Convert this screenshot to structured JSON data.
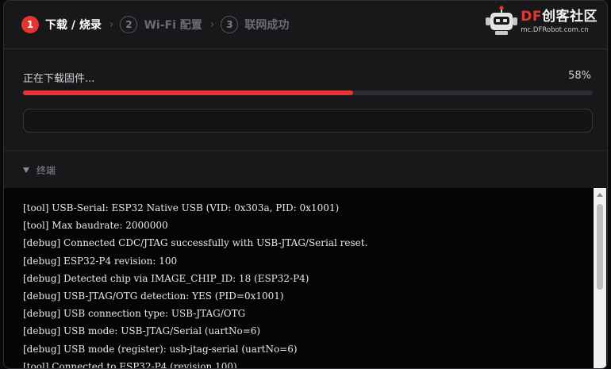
{
  "steps": [
    {
      "number": "1",
      "label": "下载 / 烧录"
    },
    {
      "number": "2",
      "label": "Wi-Fi 配置"
    },
    {
      "number": "3",
      "label": "联网成功"
    }
  ],
  "step_separator": "›",
  "logo": {
    "brand_df": "DF",
    "brand_rest": "创客社区",
    "url": "mc.DFRobot.com.cn"
  },
  "progress": {
    "status": "正在下载固件...",
    "percent_label": "58%",
    "value": 0.58
  },
  "terminal": {
    "toggle_label": "终端",
    "lines": [
      "[tool] USB-Serial: ESP32 Native USB (VID: 0x303a, PID: 0x1001)",
      "[tool] Max baudrate: 2000000",
      "[debug] Connected CDC/JTAG successfully with USB-JTAG/Serial reset.",
      "[debug] ESP32-P4 revision: 100",
      "[debug] Detected chip via IMAGE_CHIP_ID: 18 (ESP32-P4)",
      "[debug] USB-JTAG/OTG detection: YES (PID=0x1001)",
      "[debug] USB connection type: USB-JTAG/OTG",
      "[debug] USB mode: USB-JTAG/Serial (uartNo=6)",
      "[debug] USB mode (register): usb-jtag-serial (uartNo=6)",
      "[tool] Connected to ESP32-P4 (revision 100)"
    ]
  },
  "colors": {
    "accent": "#e5352f",
    "background": "#18181b",
    "terminal_bg": "#050506"
  }
}
